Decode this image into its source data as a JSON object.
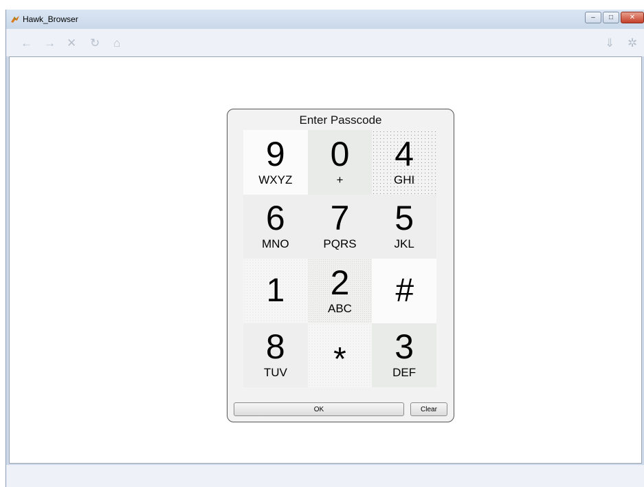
{
  "window": {
    "title": "Hawk_Browser",
    "controls": {
      "minimize": "–",
      "maximize": "□",
      "close": "✕"
    }
  },
  "toolbar": {
    "icons": [
      "back-arrow-icon",
      "forward-arrow-icon",
      "stop-icon",
      "reload-icon",
      "home-icon",
      "download-icon",
      "settings-gear-icon"
    ],
    "glyphs": {
      "back": "←",
      "forward": "→",
      "stop": "✕",
      "reload": "↻",
      "home": "⌂",
      "download": "⇓",
      "settings": "✲"
    }
  },
  "dialog": {
    "title": "Enter Passcode",
    "keys": [
      {
        "digit": "9",
        "letters": "WXYZ"
      },
      {
        "digit": "0",
        "letters": "+"
      },
      {
        "digit": "4",
        "letters": "GHI"
      },
      {
        "digit": "6",
        "letters": "MNO"
      },
      {
        "digit": "7",
        "letters": "PQRS"
      },
      {
        "digit": "5",
        "letters": "JKL"
      },
      {
        "digit": "1",
        "letters": ""
      },
      {
        "digit": "2",
        "letters": "ABC"
      },
      {
        "digit": "#",
        "letters": ""
      },
      {
        "digit": "8",
        "letters": "TUV"
      },
      {
        "digit": "*",
        "letters": ""
      },
      {
        "digit": "3",
        "letters": "DEF"
      }
    ],
    "ok_label": "OK",
    "clear_label": "Clear"
  }
}
